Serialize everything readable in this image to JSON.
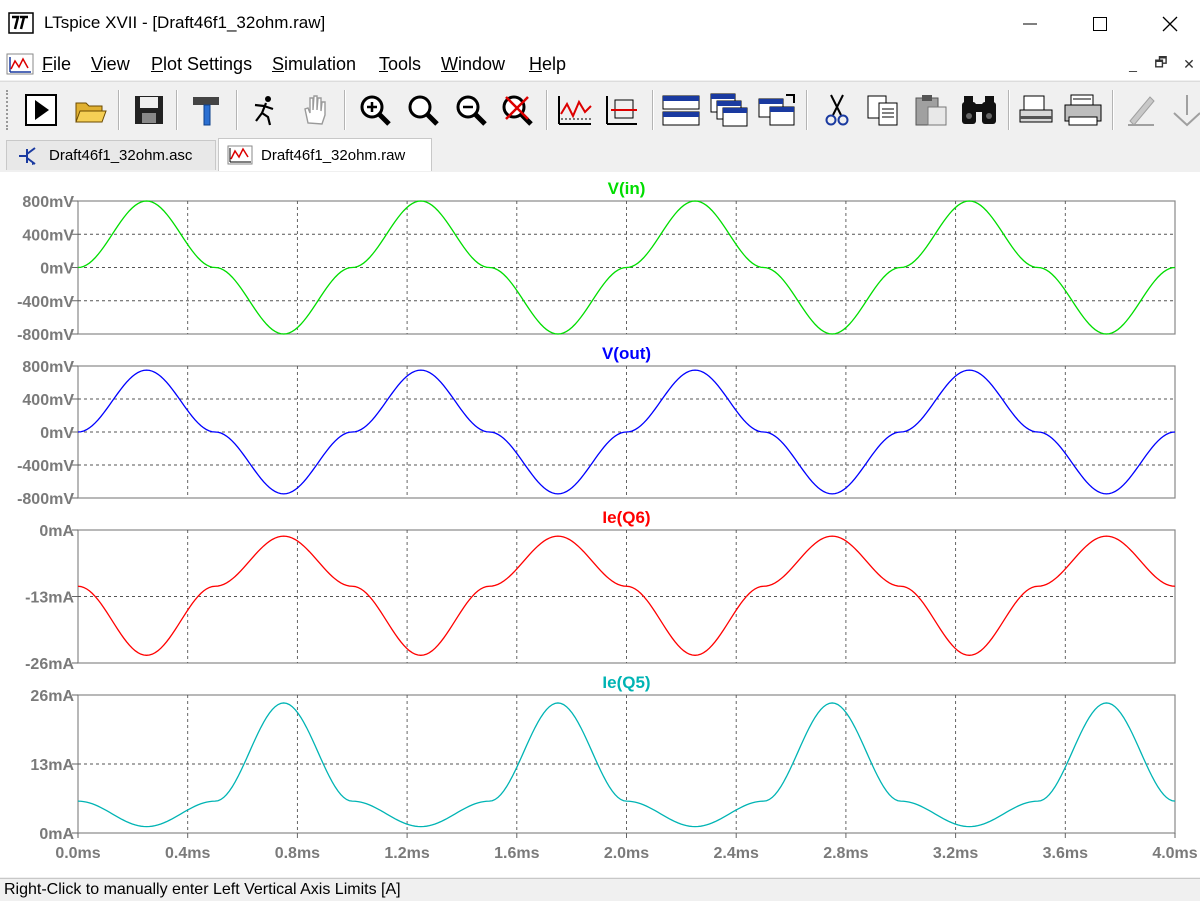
{
  "window": {
    "title": "LTspice XVII - [Draft46f1_32ohm.raw]"
  },
  "menu": {
    "items": [
      {
        "label": "File",
        "mnemonic": "F"
      },
      {
        "label": "View",
        "mnemonic": "V"
      },
      {
        "label": "Plot Settings",
        "mnemonic": "P"
      },
      {
        "label": "Simulation",
        "mnemonic": "S"
      },
      {
        "label": "Tools",
        "mnemonic": "T"
      },
      {
        "label": "Window",
        "mnemonic": "W"
      },
      {
        "label": "Help",
        "mnemonic": "H"
      }
    ]
  },
  "toolbar": {
    "buttons": [
      "run-icon",
      "open-folder-icon",
      "save-icon",
      "hammer-icon",
      "halt-icon",
      "pan-hand-icon",
      "zoom-in-icon",
      "zoom-area-icon",
      "zoom-out-icon",
      "zoom-cancel-icon",
      "autorange-icon",
      "mark-icon",
      "tile-horizontal-icon",
      "cascade-icon",
      "tile-vertical-icon",
      "cut-icon",
      "copy-icon",
      "paste-icon",
      "find-icon",
      "print-preview-icon",
      "print-icon",
      "pencil-icon",
      "down-arrow-icon"
    ]
  },
  "tabs": [
    {
      "label": "Draft46f1_32ohm.asc",
      "icon": "schematic-icon",
      "active": false
    },
    {
      "label": "Draft46f1_32ohm.raw",
      "icon": "waveform-icon",
      "active": true
    }
  ],
  "status": {
    "text": "Right-Click to manually enter Left Vertical Axis Limits [A]"
  },
  "chart_data": {
    "type": "line",
    "x_axis": {
      "unit": "ms",
      "range": [
        0,
        4.0
      ],
      "tick_labels": [
        "0.0ms",
        "0.4ms",
        "0.8ms",
        "1.2ms",
        "1.6ms",
        "2.0ms",
        "2.4ms",
        "2.8ms",
        "3.2ms",
        "3.6ms",
        "4.0ms"
      ]
    },
    "panes": [
      {
        "title": "V(in)",
        "color": "#00dd00",
        "tick_labels": [
          "800mV",
          "400mV",
          "0mV",
          "-400mV",
          "-800mV"
        ],
        "ylim": [
          -800,
          800
        ],
        "unit": "mV",
        "x": [
          0,
          0.25,
          0.5,
          0.75,
          1.0,
          1.25,
          1.5,
          1.75,
          2.0,
          2.25,
          2.5,
          2.75,
          3.0,
          3.25,
          3.5,
          3.75,
          4.0
        ],
        "y": [
          0,
          800,
          0,
          -800,
          0,
          800,
          0,
          -800,
          0,
          800,
          0,
          -800,
          0,
          800,
          0,
          -800,
          0
        ]
      },
      {
        "title": "V(out)",
        "color": "#0000ff",
        "tick_labels": [
          "800mV",
          "400mV",
          "0mV",
          "-400mV",
          "-800mV"
        ],
        "ylim": [
          -800,
          800
        ],
        "unit": "mV",
        "x": [
          0,
          0.25,
          0.5,
          0.75,
          1.0,
          1.25,
          1.5,
          1.75,
          2.0,
          2.25,
          2.5,
          2.75,
          3.0,
          3.25,
          3.5,
          3.75,
          4.0
        ],
        "y": [
          0,
          750,
          0,
          -750,
          0,
          750,
          0,
          -750,
          0,
          750,
          0,
          -750,
          0,
          750,
          0,
          -750,
          0
        ]
      },
      {
        "title": "Ie(Q6)",
        "color": "#ff0000",
        "tick_labels": [
          "0mA",
          "-13mA",
          "-26mA"
        ],
        "ylim": [
          -26,
          0
        ],
        "unit": "mA",
        "x": [
          0,
          0.25,
          0.5,
          0.75,
          1.0,
          1.25,
          1.5,
          1.75,
          2.0,
          2.25,
          2.5,
          2.75,
          3.0,
          3.25,
          3.5,
          3.75,
          4.0
        ],
        "y": [
          -11,
          -24.5,
          -11,
          -1.2,
          -11,
          -24.5,
          -11,
          -1.2,
          -11,
          -24.5,
          -11,
          -1.2,
          -11,
          -24.5,
          -11,
          -1.2,
          -11
        ]
      },
      {
        "title": "Ie(Q5)",
        "color": "#00b4b4",
        "tick_labels": [
          "26mA",
          "13mA",
          "0mA"
        ],
        "ylim": [
          0,
          26
        ],
        "unit": "mA",
        "x": [
          0,
          0.25,
          0.5,
          0.75,
          1.0,
          1.25,
          1.5,
          1.75,
          2.0,
          2.25,
          2.5,
          2.75,
          3.0,
          3.25,
          3.5,
          3.75,
          4.0
        ],
        "y": [
          6,
          1.2,
          6,
          24.5,
          6,
          1.2,
          6,
          24.5,
          6,
          1.2,
          6,
          24.5,
          6,
          1.2,
          6,
          24.5,
          6
        ]
      }
    ],
    "grid": true
  }
}
